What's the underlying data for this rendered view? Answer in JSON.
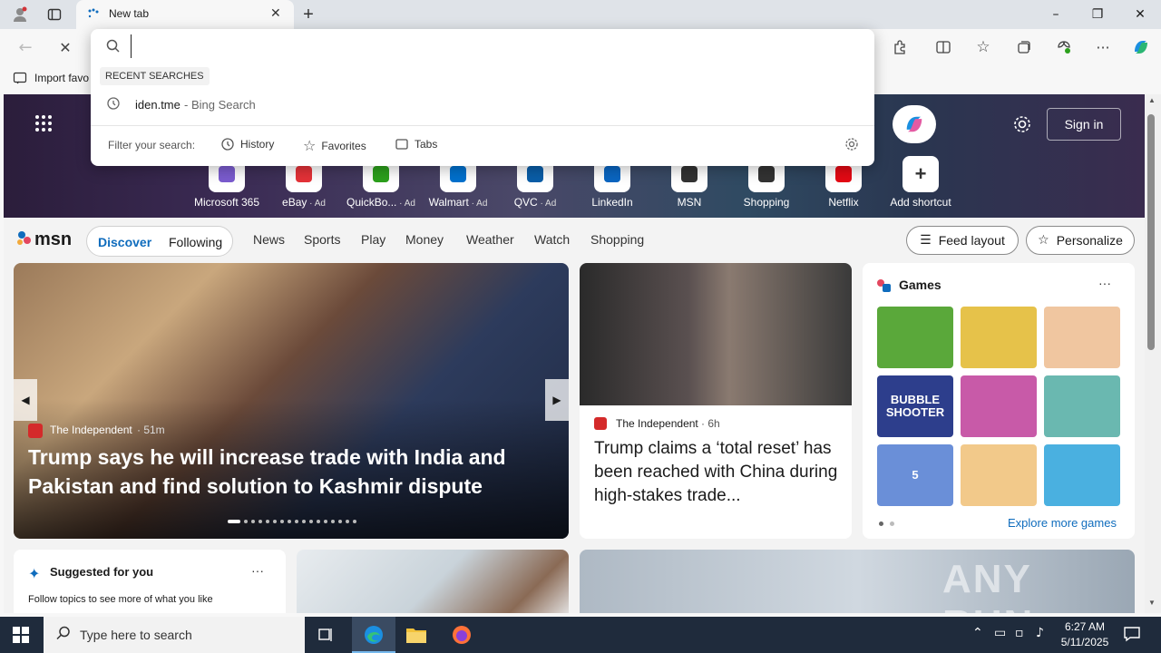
{
  "window": {
    "tab_title": "New tab",
    "minimize": "–",
    "restore": "❐",
    "close": "✕"
  },
  "favorites": {
    "import_label": "Import favo"
  },
  "omnibox": {
    "recent_header": "RECENT SEARCHES",
    "recent_query": "iden.tme",
    "recent_engine": " - Bing Search",
    "filter_label": "Filter your search:",
    "filters": [
      "History",
      "Favorites",
      "Tabs"
    ]
  },
  "hero": {
    "sign_in": "Sign in",
    "shortcuts": [
      {
        "label": "Microsoft 365",
        "ad": "",
        "icon": "microsoft365-icon",
        "color": "#7b5ccf"
      },
      {
        "label": "eBay",
        "ad": " · Ad",
        "icon": "ebay-icon",
        "color": "#e53238"
      },
      {
        "label": "QuickBo...",
        "ad": " · Ad",
        "icon": "quickbooks-icon",
        "color": "#2ca01c"
      },
      {
        "label": "Walmart",
        "ad": " · Ad",
        "icon": "walmart-icon",
        "color": "#0071ce"
      },
      {
        "label": "QVC",
        "ad": " · Ad",
        "icon": "qvc-icon",
        "color": "#0a5ea8"
      },
      {
        "label": "LinkedIn",
        "ad": "",
        "icon": "linkedin-icon",
        "color": "#0a66c2"
      },
      {
        "label": "MSN",
        "ad": "",
        "icon": "msn-icon",
        "color": "#333333"
      },
      {
        "label": "Shopping",
        "ad": "",
        "icon": "shopping-icon",
        "color": "#333333"
      },
      {
        "label": "Netflix",
        "ad": "",
        "icon": "netflix-icon",
        "color": "#e50914"
      },
      {
        "label": "Add shortcut",
        "ad": "",
        "icon": "plus-icon",
        "color": "#333333"
      }
    ]
  },
  "msn": {
    "logo": "msn",
    "tabs": [
      "Discover",
      "Following"
    ],
    "nav": [
      "News",
      "Sports",
      "Play",
      "Money",
      "Weather",
      "Watch",
      "Shopping"
    ],
    "feed_layout": "Feed layout",
    "personalize": "Personalize"
  },
  "cards": {
    "main": {
      "source": "The Independent",
      "age": " · 51m",
      "headline": "Trump says he will increase trade with India and Pakistan and find solution to Kashmir dispute"
    },
    "second": {
      "source": "The Independent",
      "age": " · 6h",
      "headline": "Trump claims a ‘total reset’ has been reached with China during high-stakes trade..."
    },
    "games": {
      "title": "Games",
      "more": "Explore more games",
      "tiles": [
        "#5aa83a",
        "#e6c24a",
        "#f0c6a0",
        "#2d3e8c",
        "#c85aa8",
        "#6ab8b0",
        "#6a8fd8",
        "#f2c98a",
        "#4ab0e0"
      ],
      "tile_texts": [
        "",
        "",
        "",
        "BUBBLE SHOOTER",
        "",
        "",
        "5",
        "",
        ""
      ]
    },
    "suggested": {
      "title": "Suggested for you",
      "body": "Follow topics to see more of what you like"
    }
  },
  "watermark": "ANY RUN",
  "taskbar": {
    "search_placeholder": "Type here to search",
    "time": "6:27 AM",
    "date": "5/11/2025"
  }
}
